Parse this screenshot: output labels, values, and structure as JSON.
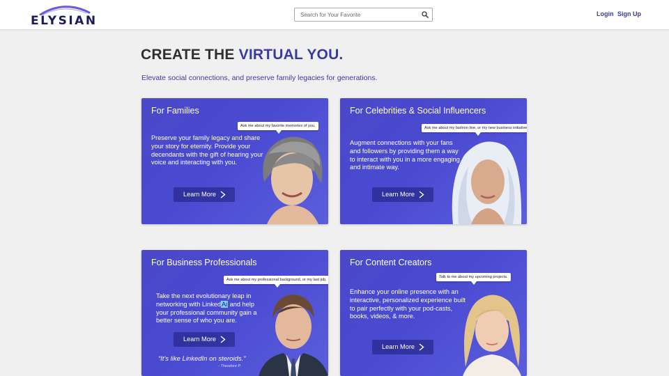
{
  "brand": {
    "logo_text": "ELYSIAN"
  },
  "search": {
    "placeholder": "Search for Your Favorite"
  },
  "nav": {
    "login": "Login",
    "signup": "Sign Up"
  },
  "hero": {
    "title_prefix": "CREATE THE ",
    "title_accent": "VIRTUAL YOU.",
    "subtitle": "Elevate social connections, and preserve family legacies for generations."
  },
  "cards": [
    {
      "title": "For Families",
      "body": "Preserve your family legacy and share your story for eternity. Provide your decendants with the gift of hearing your voice and interacting with you.",
      "bubble": "Ask me about my favorite memories of you.",
      "button": "Learn More"
    },
    {
      "title": "For Celebrities & Social Influencers",
      "body": "Augment connections with your fans and followers by providing them a way to interact with you in a more engaging and intimate way.",
      "bubble": "Ask me about my fashion line, or my new business initiatives.",
      "button": "Learn More"
    },
    {
      "title": "For Business Professionals",
      "body_before": "Take the next evolutionary leap in networking with Linked",
      "body_highlight": "Ai",
      "body_after": " and help your professional community gain a better sense of who you are.",
      "bubble": "Ask me about my professional background, or my last job.",
      "button": "Learn More",
      "quote": "“It's like LinkedIn on steroids.”",
      "quote_author": "- Theodore P."
    },
    {
      "title": "For Content Creators",
      "body": "Enhance your online presence with an interactive, personalized experience built to pair perfectly with your pod-casts, books, videos, & more.",
      "bubble": "Talk to me about my upcoming projects.",
      "button": "Learn More"
    }
  ],
  "colors": {
    "accent": "#3a3aa3",
    "card_bg": "#4b48c9",
    "page_bg": "#f1f0f1"
  }
}
